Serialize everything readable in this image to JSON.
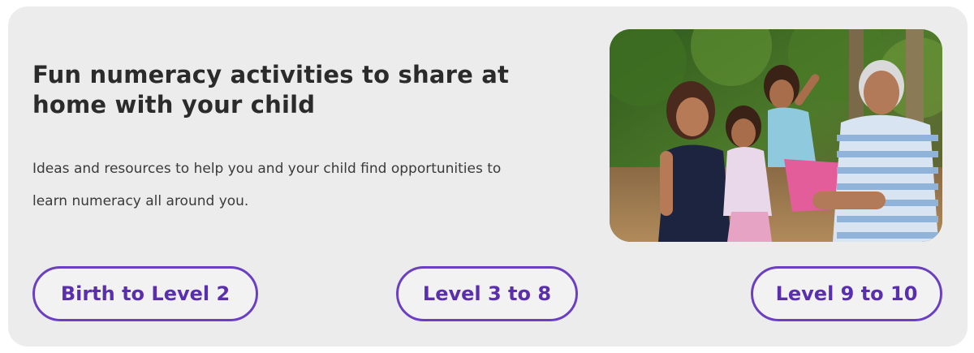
{
  "card": {
    "title": "Fun numeracy activities to share at home with your child",
    "description": "Ideas and resources to help you and your child find opportunities to learn numeracy all around you.",
    "photo_subject": "family-photo"
  },
  "levels": [
    {
      "label": "Birth to Level 2"
    },
    {
      "label": "Level 3 to 8"
    },
    {
      "label": "Level 9 to 10"
    }
  ],
  "colors": {
    "card_background": "#ececec",
    "accent_purple": "#6a3fc1",
    "button_text": "#5a2fae",
    "heading_text": "#2b2b2b"
  }
}
